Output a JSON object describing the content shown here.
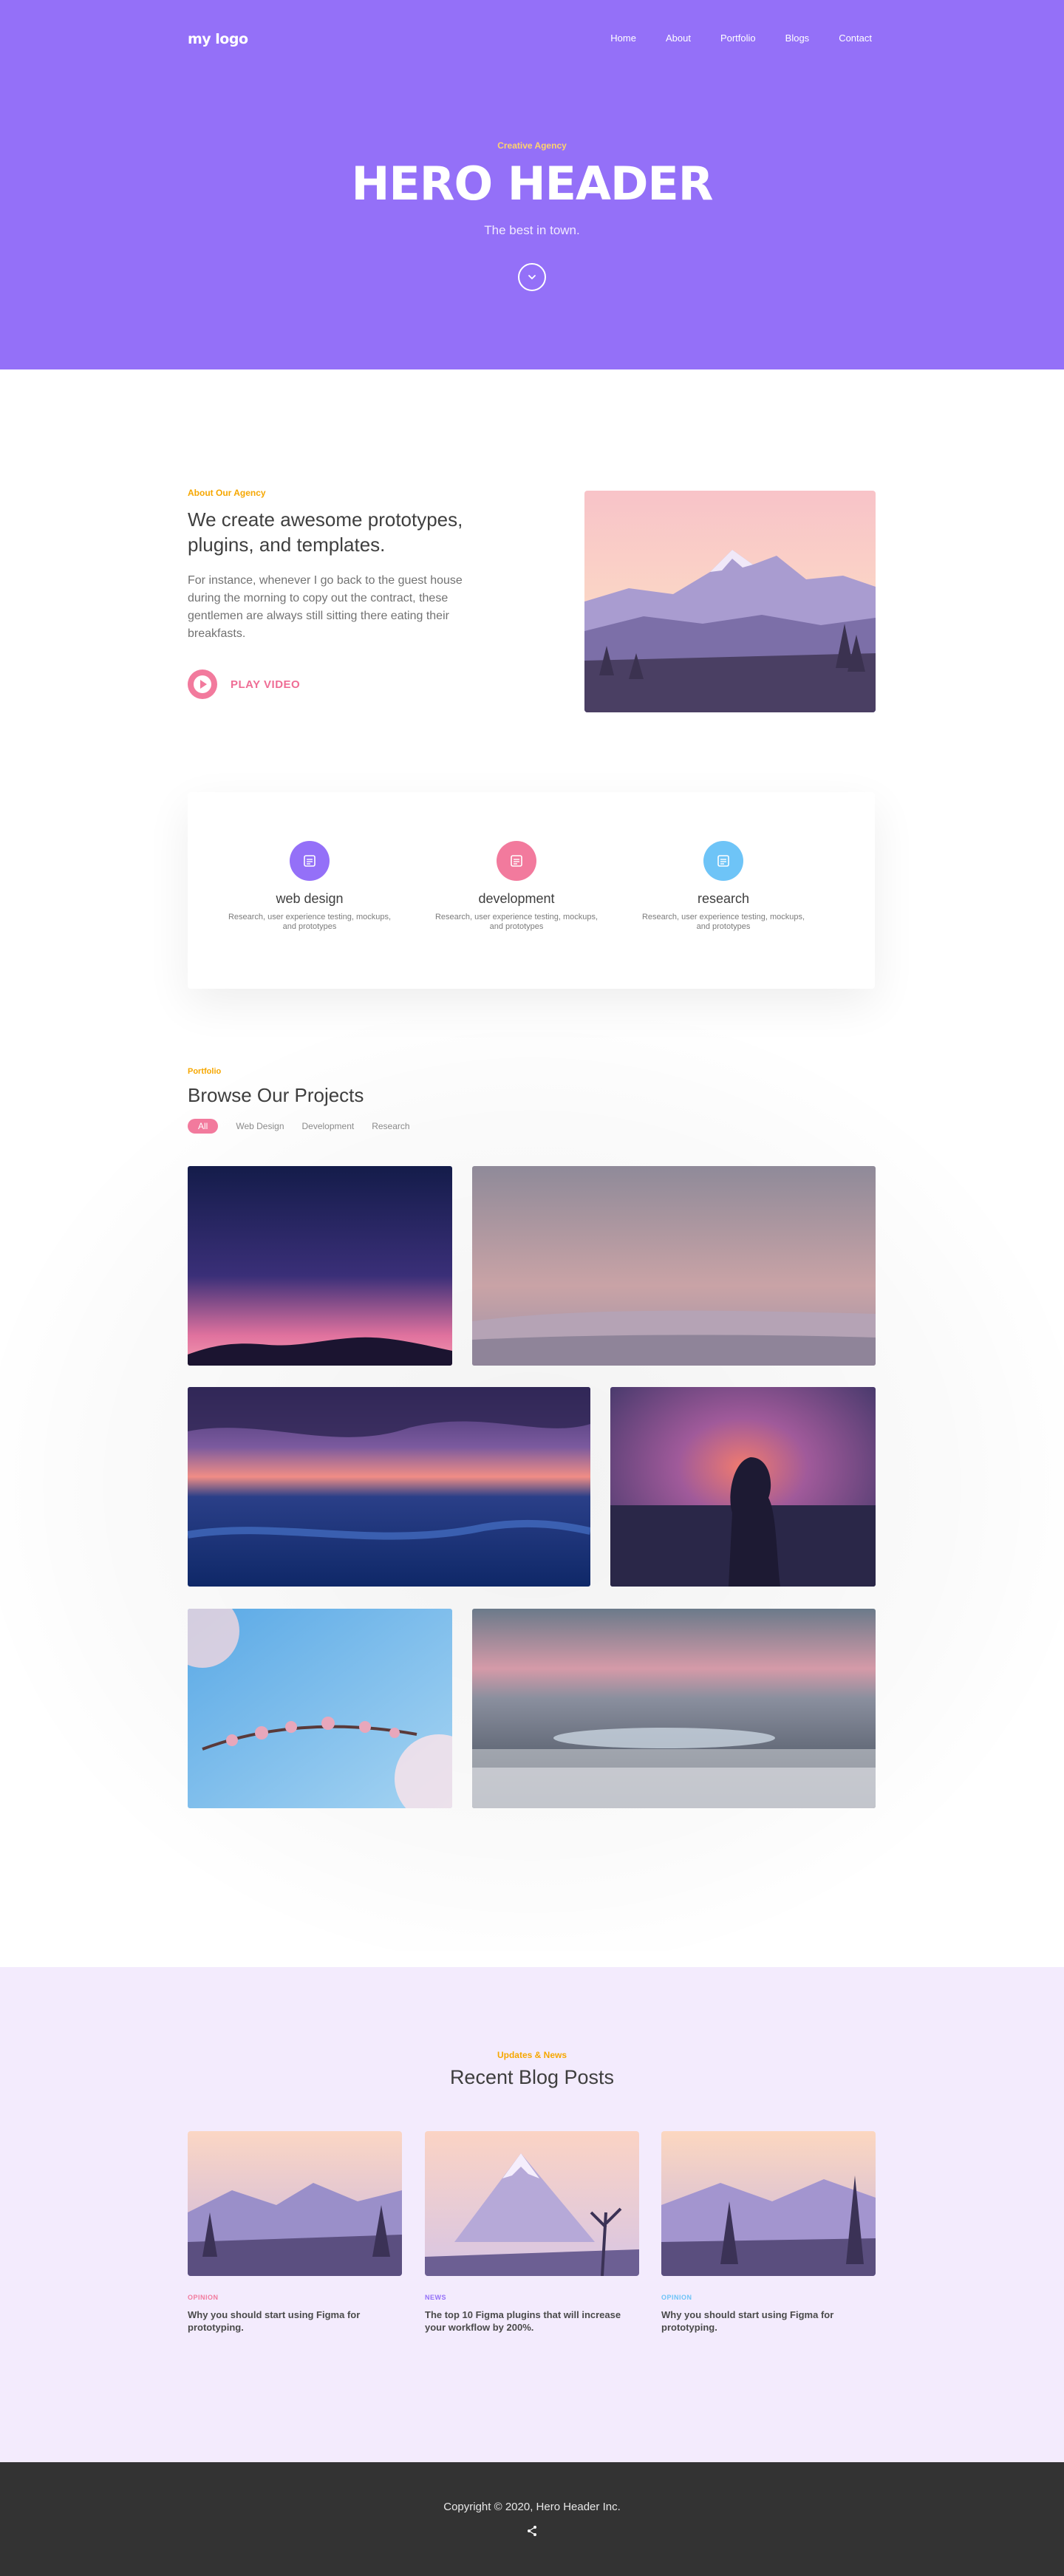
{
  "header": {
    "logo": "my logo",
    "nav": [
      "Home",
      "About",
      "Portfolio",
      "Blogs",
      "Contact"
    ]
  },
  "hero": {
    "kicker": "Creative Agency",
    "title": "HERO HEADER",
    "subtitle": "The best in town.",
    "down_icon": "chevron-down-icon"
  },
  "about": {
    "kicker": "About Our Agency",
    "title": "We create awesome prototypes, plugins, and templates.",
    "body": "For instance, whenever I go back to the guest house during the morning to copy out the contract, these gentlemen are always still sitting there eating their breakfasts.",
    "play_label": "PLAY VIDEO"
  },
  "services": [
    {
      "title": "web design",
      "desc": "Research, user experience testing, mockups, and prototypes",
      "color": "#9470f8"
    },
    {
      "title": "development",
      "desc": "Research, user experience testing, mockups, and prototypes",
      "color": "#f27a9d"
    },
    {
      "title": "research",
      "desc": "Research, user experience testing, mockups, and prototypes",
      "color": "#6ec4f7"
    }
  ],
  "portfolio": {
    "kicker": "Portfolio",
    "title": "Browse Our Projects",
    "filters": [
      "All",
      "Web Design",
      "Development",
      "Research"
    ],
    "active_filter": "All"
  },
  "blog": {
    "kicker": "Updates & News",
    "title": "Recent Blog Posts",
    "posts": [
      {
        "tag": "OPINION",
        "tag_color": "#f27a9d",
        "title": "Why you should start using Figma for prototyping."
      },
      {
        "tag": "NEWS",
        "tag_color": "#9470f8",
        "title": "The top 10 Figma plugins that will increase your workflow by 200%."
      },
      {
        "tag": "OPINION",
        "tag_color": "#6ec4f7",
        "title": "Why you should start using Figma for prototyping."
      }
    ]
  },
  "footer": {
    "copyright": "Copyright © 2020, Hero Header Inc.",
    "share_icon": "share-icon"
  },
  "colors": {
    "primary": "#9470f8",
    "accent_pink": "#f27a9d",
    "accent_orange": "#f6a700",
    "blog_bg": "#f3ebfd",
    "footer_bg": "#333333"
  }
}
